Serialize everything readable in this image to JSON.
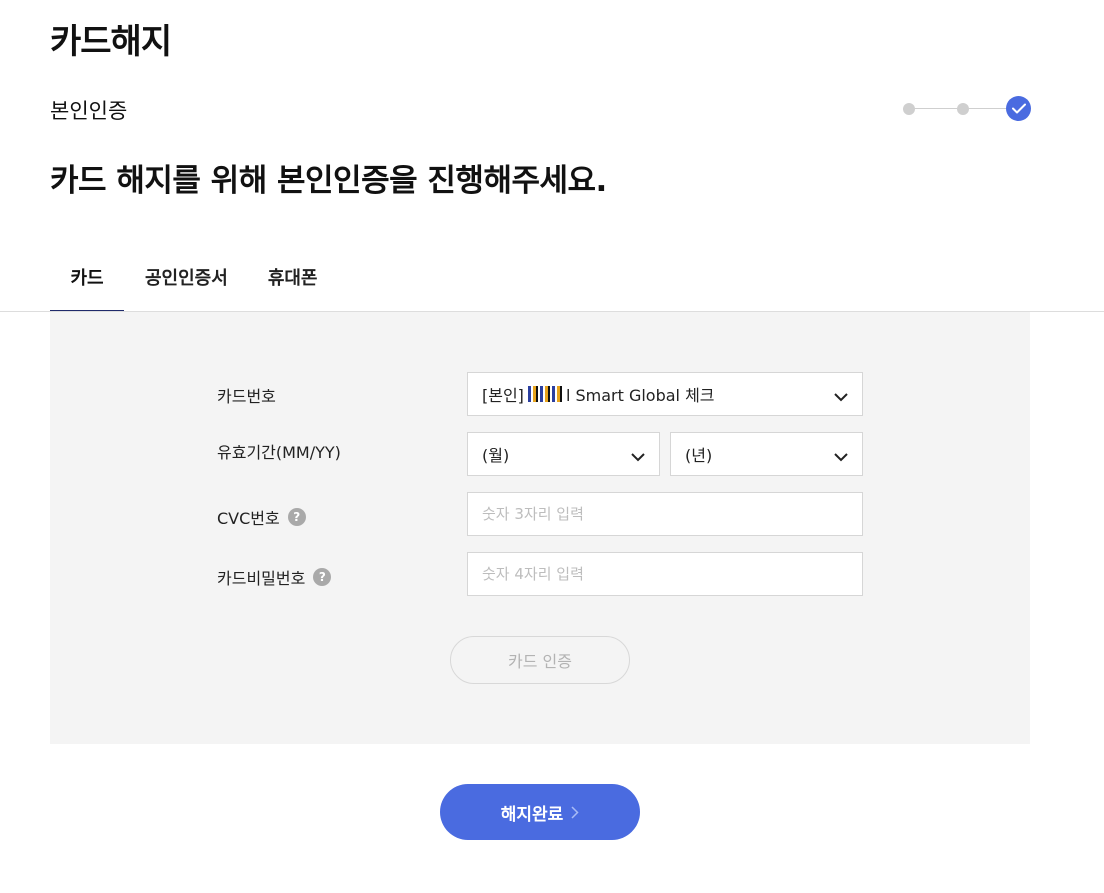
{
  "page": {
    "title": "카드해지"
  },
  "step": {
    "title": "본인인증",
    "total": 3,
    "current": 3
  },
  "headline": "카드 해지를 위해 본인인증을 진행해주세요.",
  "tabs": [
    {
      "label": "카드",
      "active": true
    },
    {
      "label": "공인인증서",
      "active": false
    },
    {
      "label": "휴대폰",
      "active": false
    }
  ],
  "form": {
    "card_number": {
      "label": "카드번호",
      "value_prefix": "[본인]",
      "value_suffix": "l Smart Global 체크"
    },
    "expiry": {
      "label": "유효기간(MM/YY)",
      "month_value": "(월)",
      "year_value": "(년)"
    },
    "cvc": {
      "label": "CVC번호",
      "placeholder": "숫자 3자리 입력"
    },
    "card_password": {
      "label": "카드비밀번호",
      "placeholder": "숫자 4자리 입력"
    },
    "help_glyph": "?",
    "verify_button": "카드 인증"
  },
  "complete_button": "해지완료",
  "colors": {
    "accent": "#4a6be0",
    "panel_bg": "#f4f4f4",
    "active_tab_underline": "#1f2a6b"
  },
  "icons": [
    "check-icon",
    "chevron-down-icon",
    "help-icon",
    "chevron-right-icon"
  ]
}
